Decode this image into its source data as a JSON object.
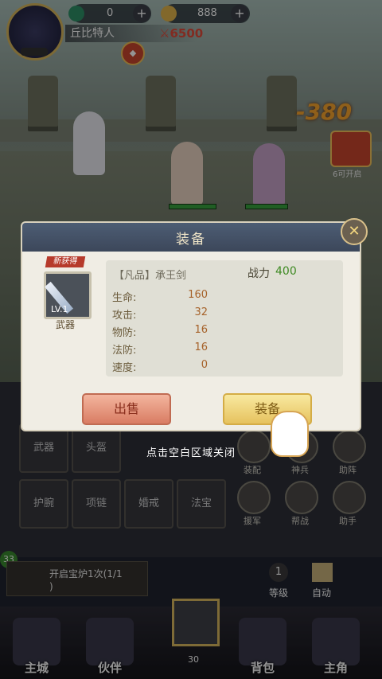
{
  "player": {
    "name": "丘比特人",
    "combat_power": "6500"
  },
  "resources": {
    "jade": "0",
    "gold": "888"
  },
  "battle": {
    "damage_text": "-380",
    "gift_label": "6可开启"
  },
  "equip_modal": {
    "title": "装备",
    "new_tag": "新获得",
    "item_level": "LV.1",
    "item_type": "武器",
    "item_name": "【凡品】承王剑",
    "power_label": "战力",
    "power_value": "400",
    "stats": [
      {
        "label": "生命:",
        "value": "160"
      },
      {
        "label": "攻击:",
        "value": "32"
      },
      {
        "label": "物防:",
        "value": "16"
      },
      {
        "label": "法防:",
        "value": "16"
      },
      {
        "label": "速度:",
        "value": "0"
      }
    ],
    "sell_label": "出售",
    "equip_label": "装备",
    "hint": "点击空白区域关闭"
  },
  "equipment_slots": [
    "武器",
    "头盔",
    "护腕",
    "项链",
    "婚戒",
    "法宝"
  ],
  "round_buttons": [
    "装配",
    "神兵",
    "助阵",
    "援军",
    "帮战",
    "助手"
  ],
  "quest": {
    "text": "开启宝炉1次(1/1",
    "suffix": ")",
    "level": "33"
  },
  "side_buttons": {
    "level_label": "等级",
    "level_value": "1",
    "auto_label": "自动"
  },
  "bottom_nav": {
    "items": [
      "主城",
      "伙伴",
      "背包",
      "主角"
    ],
    "center_count": "30"
  },
  "colors": {
    "power_green": "#3e8a23",
    "damage_orange": "#f7a42d",
    "sell_button": "#d97c63",
    "equip_button": "#e6c25e"
  }
}
